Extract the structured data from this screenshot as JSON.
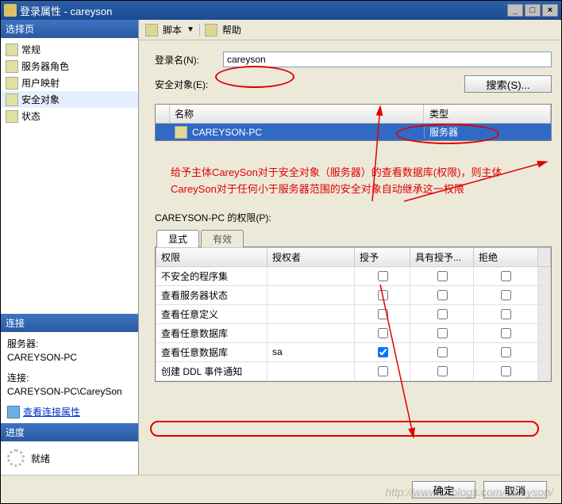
{
  "window": {
    "title": "登录属性 - careyson"
  },
  "left": {
    "select_page": "选择页",
    "pages": [
      "常规",
      "服务器角色",
      "用户映射",
      "安全对象",
      "状态"
    ],
    "selected_index": 3,
    "connection": "连接",
    "server_lbl": "服务器:",
    "server_val": "CAREYSON-PC",
    "conn_lbl": "连接:",
    "conn_val": "CAREYSON-PC\\CareySon",
    "view_conn": "查看连接属性",
    "progress": "进度",
    "ready": "就绪"
  },
  "toolbar": {
    "script": "脚本",
    "help": "帮助"
  },
  "form": {
    "login_label": "登录名(N):",
    "login_value": "careyson",
    "securable_label": "安全对象(E):",
    "search_btn": "搜索(S)..."
  },
  "grid1": {
    "col_name": "名称",
    "col_type": "类型",
    "row_name": "CAREYSON-PC",
    "row_type": "服务器"
  },
  "annotation": "给予主体CareySon对于安全对象（服务器）的查看数据库(权限)，则主体CareySon对于任何小于服务器范围的安全对象自动继承这一权限",
  "perm": {
    "label": "CAREYSON-PC 的权限(P):",
    "tab_explicit": "显式",
    "tab_effective": "有效",
    "col_perm": "权限",
    "col_grantor": "授权者",
    "col_grant": "授予",
    "col_withgrant": "具有授予...",
    "col_deny": "拒绝",
    "rows": [
      {
        "perm": "不安全的程序集",
        "grantor": "",
        "grant": false,
        "with": false,
        "deny": false
      },
      {
        "perm": "查看服务器状态",
        "grantor": "",
        "grant": false,
        "with": false,
        "deny": false
      },
      {
        "perm": "查看任意定义",
        "grantor": "",
        "grant": false,
        "with": false,
        "deny": false
      },
      {
        "perm": "查看任意数据库",
        "grantor": "",
        "grant": false,
        "with": false,
        "deny": false
      },
      {
        "perm": "查看任意数据库",
        "grantor": "sa",
        "grant": true,
        "with": false,
        "deny": false
      },
      {
        "perm": "创建 DDL 事件通知",
        "grantor": "",
        "grant": false,
        "with": false,
        "deny": false
      }
    ]
  },
  "buttons": {
    "ok": "确定",
    "cancel": "取消"
  },
  "watermark": "http://www.cnblogs.com/careyson/"
}
